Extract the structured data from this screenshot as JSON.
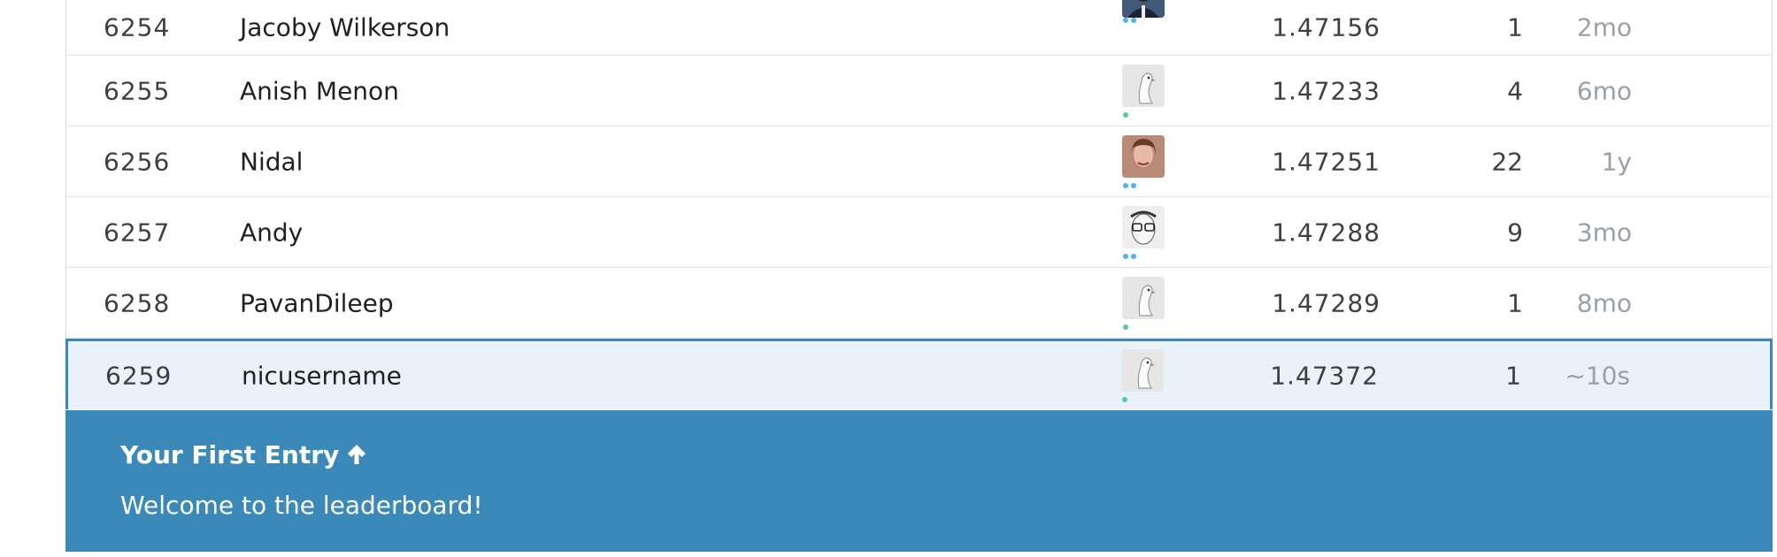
{
  "leaderboard": {
    "rows": [
      {
        "rank": "6254",
        "name": "Jacoby Wilkerson",
        "avatar": "person-photo-icon",
        "tier": "contributor",
        "score": "1.47156",
        "entries": "1",
        "last": "2mo"
      },
      {
        "rank": "6255",
        "name": "Anish Menon",
        "avatar": "default-goose-avatar-icon",
        "tier": "novice",
        "score": "1.47233",
        "entries": "4",
        "last": "6mo"
      },
      {
        "rank": "6256",
        "name": "Nidal",
        "avatar": "person-photo-icon",
        "tier": "contributor",
        "score": "1.47251",
        "entries": "22",
        "last": "1y"
      },
      {
        "rank": "6257",
        "name": "Andy",
        "avatar": "person-sketch-icon",
        "tier": "contributor",
        "score": "1.47288",
        "entries": "9",
        "last": "3mo"
      },
      {
        "rank": "6258",
        "name": "PavanDileep",
        "avatar": "default-goose-avatar-icon",
        "tier": "novice",
        "score": "1.47289",
        "entries": "1",
        "last": "8mo"
      },
      {
        "rank": "6259",
        "name": "nicusername",
        "avatar": "default-goose-avatar-icon",
        "tier": "novice",
        "score": "1.47372",
        "entries": "1",
        "last": "~10s",
        "highlighted": true
      }
    ],
    "colors": {
      "highlight_border": "#3b89b8",
      "highlight_bg": "#ebf1f8",
      "tier_novice": "#5ac7a0",
      "tier_contributor": "#4fb3ea"
    }
  },
  "banner": {
    "title": "Your First Entry",
    "arrow_icon": "arrow-up-icon",
    "message": "Welcome to the leaderboard!",
    "color": "#3b89b8"
  }
}
